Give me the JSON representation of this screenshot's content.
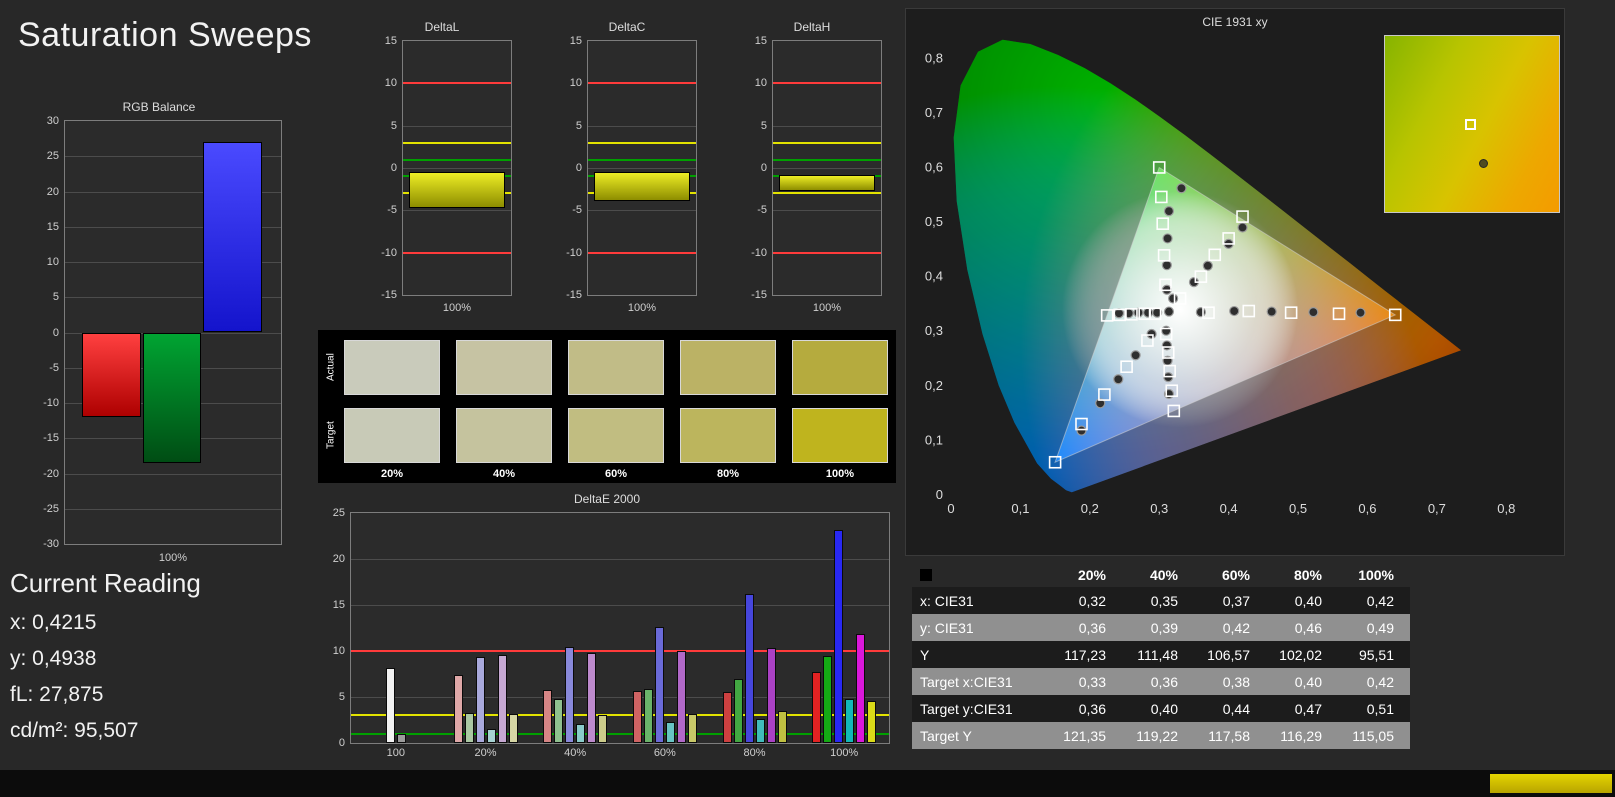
{
  "page": {
    "title": "Saturation Sweeps",
    "background": "#282828"
  },
  "current_reading": {
    "title": "Current Reading",
    "lines": [
      {
        "label": "x:",
        "value": "0,4215"
      },
      {
        "label": "y:",
        "value": "0,4938"
      },
      {
        "label": "fL:",
        "value": "27,875"
      },
      {
        "label": "cd/m²:",
        "value": "95,507"
      }
    ]
  },
  "swatches": {
    "row_labels": [
      "Actual",
      "Target"
    ],
    "columns": [
      "20%",
      "40%",
      "60%",
      "80%",
      "100%"
    ],
    "actual_colors": [
      "#c9cbbb",
      "#c6c3a3",
      "#c1bc87",
      "#bbb265",
      "#b5ab3e"
    ],
    "target_colors": [
      "#c8cab7",
      "#c5c39e",
      "#c1bd81",
      "#bcb55d",
      "#bfb41e"
    ]
  },
  "table": {
    "columns": [
      "20%",
      "40%",
      "60%",
      "80%",
      "100%"
    ],
    "rows": [
      {
        "label": "x: CIE31",
        "values": [
          "0,32",
          "0,35",
          "0,37",
          "0,40",
          "0,42"
        ]
      },
      {
        "label": "y: CIE31",
        "values": [
          "0,36",
          "0,39",
          "0,42",
          "0,46",
          "0,49"
        ]
      },
      {
        "label": "Y",
        "values": [
          "117,23",
          "111,48",
          "106,57",
          "102,02",
          "95,51"
        ]
      },
      {
        "label": "Target x:CIE31",
        "values": [
          "0,33",
          "0,36",
          "0,38",
          "0,40",
          "0,42"
        ]
      },
      {
        "label": "Target y:CIE31",
        "values": [
          "0,36",
          "0,40",
          "0,44",
          "0,47",
          "0,51"
        ]
      },
      {
        "label": "Target Y",
        "values": [
          "121,35",
          "119,22",
          "117,58",
          "116,29",
          "115,05"
        ]
      }
    ]
  },
  "footer": {
    "accent_color_top": "#e4d400",
    "accent_color_bottom": "#b8a400"
  },
  "chart_data": [
    {
      "type": "bar",
      "title": "RGB Balance",
      "xlabel": "100%",
      "ylabel": "",
      "ylim": [
        -30,
        30
      ],
      "ytick_step": 5,
      "categories": [
        "Red",
        "Green",
        "Blue"
      ],
      "values": [
        -12,
        -18.5,
        27
      ],
      "bar_gradients": [
        [
          "#ff4040",
          "#ae0000"
        ],
        [
          "#00a432",
          "#004d14"
        ],
        [
          "#4a4aff",
          "#1414cc"
        ]
      ]
    },
    {
      "type": "bar",
      "title": "DeltaL",
      "xlabel": "100%",
      "ylim": [
        -15,
        15
      ],
      "ytick_step": 5,
      "bar": {
        "from": -0.5,
        "to": -4.7
      },
      "bar_gradient": [
        "#eded25",
        "#8d8d00"
      ],
      "limit_lines": [
        {
          "value": 10,
          "color": "#ff3b3b"
        },
        {
          "value": -10,
          "color": "#ff3b3b"
        },
        {
          "value": 3,
          "color": "#e3e300"
        },
        {
          "value": -3,
          "color": "#e3e300"
        },
        {
          "value": 1,
          "color": "#00a000"
        },
        {
          "value": -1,
          "color": "#00a000"
        }
      ]
    },
    {
      "type": "bar",
      "title": "DeltaC",
      "xlabel": "100%",
      "ylim": [
        -15,
        15
      ],
      "ytick_step": 5,
      "bar": {
        "from": -0.5,
        "to": -3.9
      },
      "bar_gradient": [
        "#eded25",
        "#8d8d00"
      ],
      "limit_lines": [
        {
          "value": 10,
          "color": "#ff3b3b"
        },
        {
          "value": -10,
          "color": "#ff3b3b"
        },
        {
          "value": 3,
          "color": "#e3e300"
        },
        {
          "value": -3,
          "color": "#e3e300"
        },
        {
          "value": 1,
          "color": "#00a000"
        },
        {
          "value": -1,
          "color": "#00a000"
        }
      ]
    },
    {
      "type": "bar",
      "title": "DeltaH",
      "xlabel": "100%",
      "ylim": [
        -15,
        15
      ],
      "ytick_step": 5,
      "bar": {
        "from": -0.8,
        "to": -2.7
      },
      "bar_gradient": [
        "#eded25",
        "#8d8d00"
      ],
      "limit_lines": [
        {
          "value": 10,
          "color": "#ff3b3b"
        },
        {
          "value": -10,
          "color": "#ff3b3b"
        },
        {
          "value": 3,
          "color": "#e3e300"
        },
        {
          "value": -3,
          "color": "#e3e300"
        },
        {
          "value": 1,
          "color": "#00a000"
        },
        {
          "value": -1,
          "color": "#00a000"
        }
      ]
    },
    {
      "type": "bar",
      "title": "DeltaE 2000",
      "ylim": [
        0,
        25
      ],
      "ytick_step": 5,
      "limit_lines": [
        {
          "value": 10,
          "color": "#ff3b3b"
        },
        {
          "value": 3,
          "color": "#e3e300"
        },
        {
          "value": 1,
          "color": "#00a000"
        }
      ],
      "groups": [
        {
          "label": "100",
          "bars": [
            {
              "color": "#f2f2f2",
              "value": 8.2
            },
            {
              "color": "#9c9c9c",
              "value": 1.0
            }
          ]
        },
        {
          "label": "20%",
          "bars": [
            {
              "color": "#dfa8a8",
              "value": 7.4
            },
            {
              "color": "#abc8a3",
              "value": 3.3
            },
            {
              "color": "#a9a9dc",
              "value": 9.3
            },
            {
              "color": "#a6d2d2",
              "value": 1.5
            },
            {
              "color": "#c6a8d2",
              "value": 9.6
            },
            {
              "color": "#d6d6a4",
              "value": 3.1
            }
          ]
        },
        {
          "label": "40%",
          "bars": [
            {
              "color": "#d68585",
              "value": 5.8
            },
            {
              "color": "#8fc08f",
              "value": 4.8
            },
            {
              "color": "#8989da",
              "value": 10.4
            },
            {
              "color": "#8accca",
              "value": 2.1
            },
            {
              "color": "#bd8acc",
              "value": 9.8
            },
            {
              "color": "#cccc8a",
              "value": 3.0
            }
          ]
        },
        {
          "label": "60%",
          "bars": [
            {
              "color": "#cf6363",
              "value": 5.6
            },
            {
              "color": "#6ab36a",
              "value": 5.9
            },
            {
              "color": "#6a6ad8",
              "value": 12.6
            },
            {
              "color": "#68c4c4",
              "value": 2.3
            },
            {
              "color": "#b168c8",
              "value": 10.0
            },
            {
              "color": "#c8c868",
              "value": 3.2
            }
          ]
        },
        {
          "label": "80%",
          "bars": [
            {
              "color": "#cd4040",
              "value": 5.5
            },
            {
              "color": "#42a742",
              "value": 7.0
            },
            {
              "color": "#4646dc",
              "value": 16.2
            },
            {
              "color": "#41bcbc",
              "value": 2.6
            },
            {
              "color": "#aa41c4",
              "value": 10.3
            },
            {
              "color": "#c0c041",
              "value": 3.5
            }
          ]
        },
        {
          "label": "100%",
          "bars": [
            {
              "color": "#e22222",
              "value": 7.7
            },
            {
              "color": "#14aa14",
              "value": 9.5
            },
            {
              "color": "#2828f2",
              "value": 23.1
            },
            {
              "color": "#12b8b8",
              "value": 4.8
            },
            {
              "color": "#da18da",
              "value": 11.8
            },
            {
              "color": "#dada18",
              "value": 4.6
            }
          ]
        }
      ]
    },
    {
      "type": "scatter",
      "title": "CIE 1931 xy",
      "xlim": [
        0,
        0.85
      ],
      "ylim": [
        0,
        0.85
      ],
      "tick_step": 0.1,
      "tick_labels": [
        "0",
        "0,1",
        "0,2",
        "0,3",
        "0,4",
        "0,5",
        "0,6",
        "0,7",
        "0,8"
      ],
      "gamut_triangle": [
        [
          0.64,
          0.33
        ],
        [
          0.3,
          0.6
        ],
        [
          0.15,
          0.06
        ]
      ],
      "spectral_locus": [
        [
          0.1741,
          0.005
        ],
        [
          0.1658,
          0.0086
        ],
        [
          0.1566,
          0.0177
        ],
        [
          0.144,
          0.0297
        ],
        [
          0.1241,
          0.0578
        ],
        [
          0.0913,
          0.1327
        ],
        [
          0.0687,
          0.2007
        ],
        [
          0.0454,
          0.295
        ],
        [
          0.0235,
          0.4127
        ],
        [
          0.0082,
          0.5384
        ],
        [
          0.0039,
          0.6548
        ],
        [
          0.0139,
          0.7502
        ],
        [
          0.0389,
          0.812
        ],
        [
          0.0743,
          0.8338
        ],
        [
          0.1142,
          0.8262
        ],
        [
          0.1547,
          0.8059
        ],
        [
          0.1929,
          0.7816
        ],
        [
          0.2296,
          0.7543
        ],
        [
          0.2658,
          0.7243
        ],
        [
          0.3016,
          0.6923
        ],
        [
          0.3373,
          0.6589
        ],
        [
          0.3731,
          0.6245
        ],
        [
          0.4087,
          0.5896
        ],
        [
          0.4441,
          0.5547
        ],
        [
          0.4788,
          0.5202
        ],
        [
          0.5125,
          0.4866
        ],
        [
          0.5448,
          0.4544
        ],
        [
          0.5752,
          0.4242
        ],
        [
          0.6029,
          0.3965
        ],
        [
          0.627,
          0.3725
        ],
        [
          0.6482,
          0.3514
        ],
        [
          0.6658,
          0.334
        ],
        [
          0.6915,
          0.3083
        ],
        [
          0.7079,
          0.292
        ],
        [
          0.7347,
          0.2653
        ]
      ],
      "target_points": [
        [
          0.371,
          0.334
        ],
        [
          0.429,
          0.337
        ],
        [
          0.49,
          0.334
        ],
        [
          0.559,
          0.332
        ],
        [
          0.64,
          0.33
        ],
        [
          0.309,
          0.385
        ],
        [
          0.307,
          0.439
        ],
        [
          0.305,
          0.497
        ],
        [
          0.303,
          0.546
        ],
        [
          0.3,
          0.6
        ],
        [
          0.283,
          0.283
        ],
        [
          0.253,
          0.235
        ],
        [
          0.221,
          0.184
        ],
        [
          0.188,
          0.13
        ],
        [
          0.15,
          0.06
        ],
        [
          0.294,
          0.332
        ],
        [
          0.279,
          0.332
        ],
        [
          0.26,
          0.331
        ],
        [
          0.243,
          0.33
        ],
        [
          0.225,
          0.329
        ],
        [
          0.31,
          0.295
        ],
        [
          0.313,
          0.261
        ],
        [
          0.315,
          0.227
        ],
        [
          0.318,
          0.191
        ],
        [
          0.321,
          0.154
        ],
        [
          0.33,
          0.36
        ],
        [
          0.36,
          0.4
        ],
        [
          0.38,
          0.44
        ],
        [
          0.4,
          0.47
        ],
        [
          0.42,
          0.51
        ]
      ],
      "measured_points": [
        [
          0.314,
          0.336
        ],
        [
          0.36,
          0.335
        ],
        [
          0.408,
          0.337
        ],
        [
          0.462,
          0.336
        ],
        [
          0.522,
          0.335
        ],
        [
          0.59,
          0.334
        ],
        [
          0.311,
          0.376
        ],
        [
          0.311,
          0.421
        ],
        [
          0.312,
          0.47
        ],
        [
          0.314,
          0.52
        ],
        [
          0.332,
          0.562
        ],
        [
          0.289,
          0.295
        ],
        [
          0.266,
          0.256
        ],
        [
          0.241,
          0.212
        ],
        [
          0.215,
          0.168
        ],
        [
          0.188,
          0.118
        ],
        [
          0.297,
          0.334
        ],
        [
          0.284,
          0.334
        ],
        [
          0.27,
          0.334
        ],
        [
          0.256,
          0.333
        ],
        [
          0.242,
          0.333
        ],
        [
          0.31,
          0.301
        ],
        [
          0.311,
          0.274
        ],
        [
          0.312,
          0.246
        ],
        [
          0.313,
          0.216
        ],
        [
          0.314,
          0.185
        ],
        [
          0.32,
          0.36
        ],
        [
          0.35,
          0.39
        ],
        [
          0.37,
          0.42
        ],
        [
          0.4,
          0.46
        ],
        [
          0.42,
          0.49
        ]
      ],
      "inset": {
        "square": [
          0.46,
          0.47
        ],
        "dot": [
          0.54,
          0.7
        ]
      }
    }
  ]
}
